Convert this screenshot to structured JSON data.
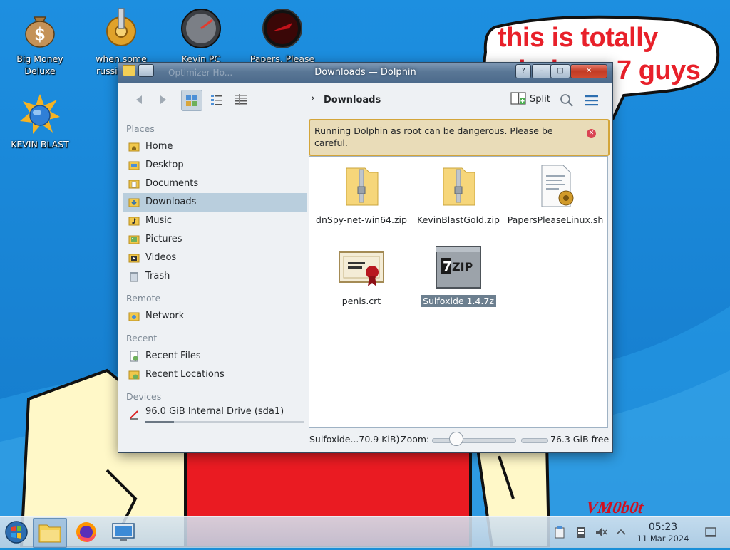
{
  "desktop": {
    "icons": [
      {
        "label": "Big Money Deluxe"
      },
      {
        "label": "when some russian tr..."
      },
      {
        "label": "Kevin PC Optimizer Ho..."
      },
      {
        "label": "Papers, Please"
      },
      {
        "label": "KEVIN BLAST"
      }
    ],
    "bubble_text": "this is totally windows 7 guys",
    "watermark": "VM0b0t"
  },
  "window": {
    "title": "Downloads — Dolphin",
    "ghost_title": "Optimizer Ho...",
    "close_label": "✕",
    "help_label": "?",
    "min_label": "–",
    "max_label": "□"
  },
  "toolbar": {
    "breadcrumb": "Downloads",
    "split_label": "Split"
  },
  "sidebar": {
    "sections": [
      {
        "title": "Places"
      },
      {
        "title": "Remote"
      },
      {
        "title": "Recent"
      },
      {
        "title": "Devices"
      }
    ],
    "places": [
      "Home",
      "Desktop",
      "Documents",
      "Downloads",
      "Music",
      "Pictures",
      "Videos",
      "Trash"
    ],
    "remote": [
      "Network"
    ],
    "recent": [
      "Recent Files",
      "Recent Locations"
    ],
    "devices": [
      {
        "label": "96.0 GiB Internal Drive (sda1)",
        "used_fraction": 0.18
      }
    ],
    "selected": "Downloads"
  },
  "warning": {
    "text": "Running Dolphin as root can be dangerous. Please be careful."
  },
  "files": [
    {
      "name": "dnSpy-net-win64.zip",
      "icon": "zip-folder-icon"
    },
    {
      "name": "KevinBlastGold.zip",
      "icon": "zip-folder-icon"
    },
    {
      "name": "PapersPleaseLinux.sh",
      "icon": "script-icon"
    },
    {
      "name": "penis.crt",
      "icon": "certificate-icon"
    },
    {
      "name": "Sulfoxide 1.4.7z",
      "icon": "7zip-icon",
      "selected": true
    }
  ],
  "statusbar": {
    "file_info": "Sulfoxide...70.9 KiB)",
    "zoom_label": "Zoom:",
    "free_space": "76.3 GiB free"
  },
  "taskbar": {
    "time": "05:23",
    "date": "11 Mar 2024"
  },
  "colors": {
    "accent": "#3daee9",
    "selection": "#b9cedd",
    "warning_border": "#d3a53a",
    "close_button": "#c23b24"
  }
}
